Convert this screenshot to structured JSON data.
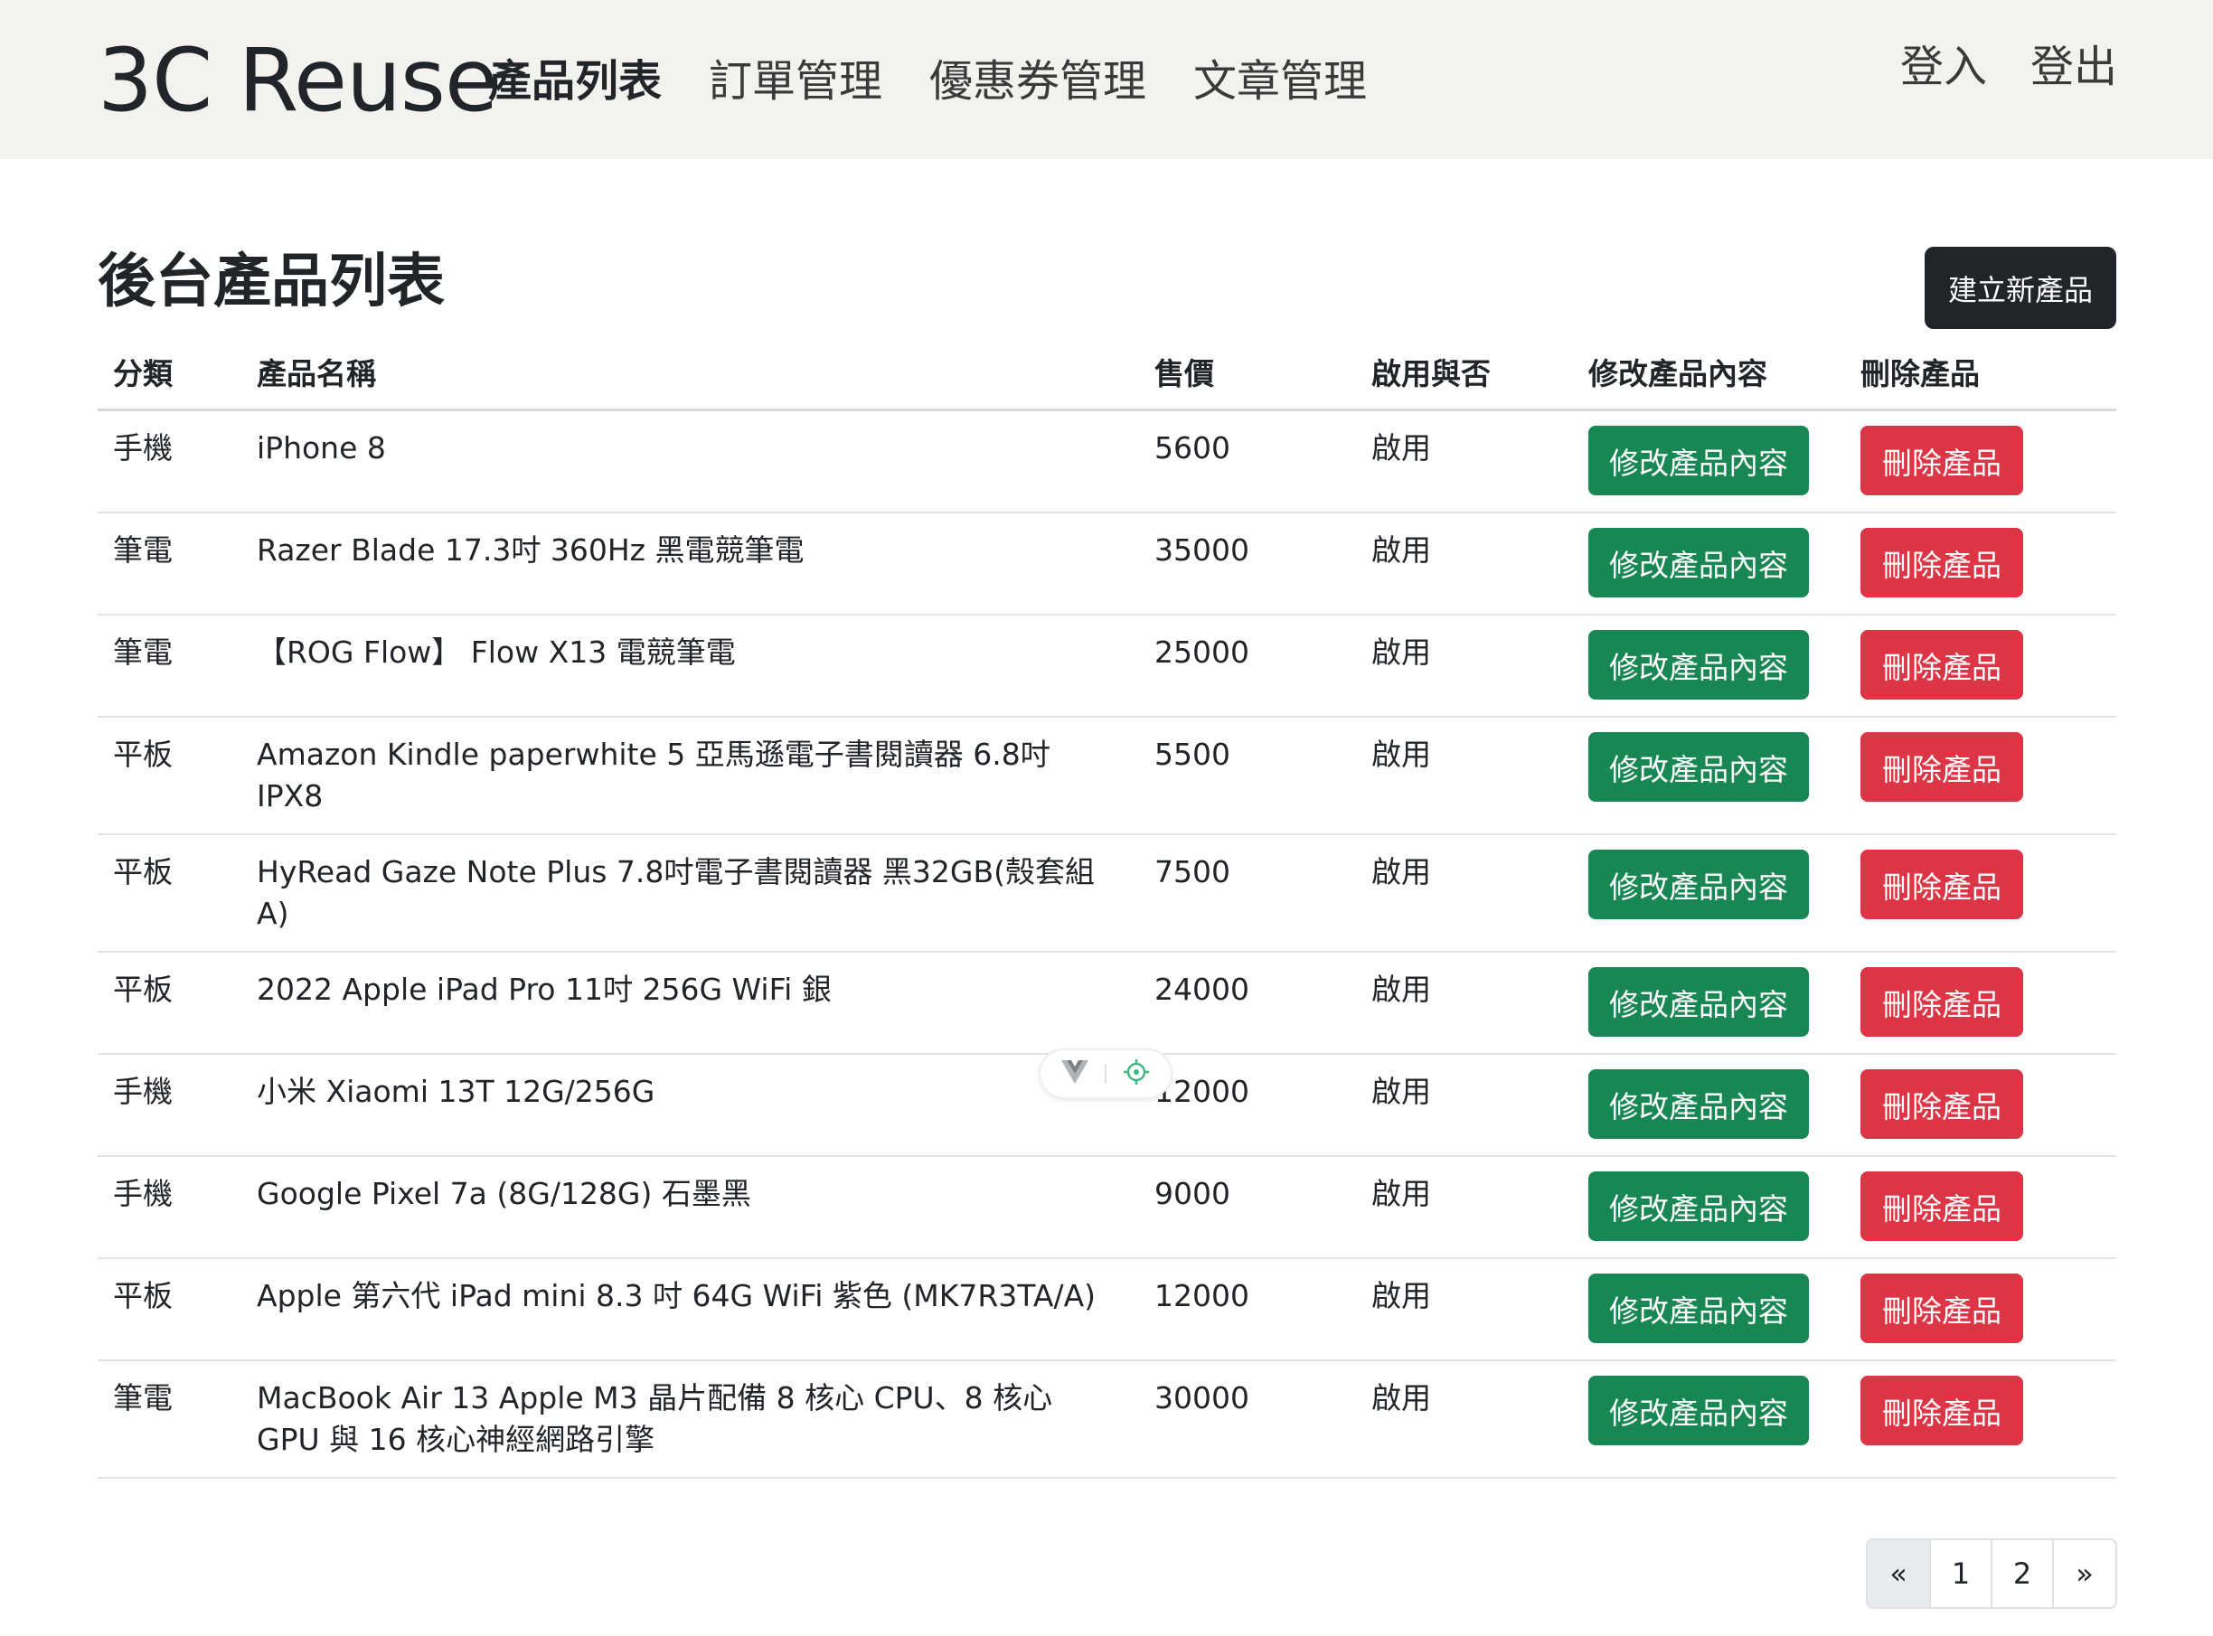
{
  "navbar": {
    "brand": "3C Reuse",
    "links": [
      {
        "label": "產品列表",
        "active": true
      },
      {
        "label": "訂單管理",
        "active": false
      },
      {
        "label": "優惠券管理",
        "active": false
      },
      {
        "label": "文章管理",
        "active": false
      }
    ],
    "login_label": "登入",
    "logout_label": "登出"
  },
  "page": {
    "title": "後台產品列表",
    "create_button_label": "建立新產品"
  },
  "table": {
    "headers": {
      "category": "分類",
      "name": "產品名稱",
      "price": "售價",
      "status": "啟用與否",
      "edit": "修改產品內容",
      "delete": "刪除產品"
    },
    "edit_button_label": "修改產品內容",
    "delete_button_label": "刪除產品",
    "rows": [
      {
        "category": "手機",
        "name": "iPhone 8",
        "price": "5600",
        "status": "啟用"
      },
      {
        "category": "筆電",
        "name": "Razer Blade 17.3吋 360Hz 黑電競筆電",
        "price": "35000",
        "status": "啟用"
      },
      {
        "category": "筆電",
        "name": "【ROG Flow】 Flow X13 電競筆電",
        "price": "25000",
        "status": "啟用"
      },
      {
        "category": "平板",
        "name": "Amazon Kindle paperwhite 5 亞馬遜電子書閱讀器 6.8吋 IPX8",
        "price": "5500",
        "status": "啟用"
      },
      {
        "category": "平板",
        "name": "HyRead Gaze Note Plus 7.8吋電子書閱讀器 黑32GB(殼套組A)",
        "price": "7500",
        "status": "啟用"
      },
      {
        "category": "平板",
        "name": "2022 Apple iPad Pro 11吋 256G WiFi 銀",
        "price": "24000",
        "status": "啟用"
      },
      {
        "category": "手機",
        "name": "小米 Xiaomi 13T 12G/256G",
        "price": "12000",
        "status": "啟用"
      },
      {
        "category": "手機",
        "name": "Google Pixel 7a (8G/128G) 石墨黑",
        "price": "9000",
        "status": "啟用"
      },
      {
        "category": "平板",
        "name": "Apple 第六代 iPad mini 8.3 吋 64G WiFi 紫色 (MK7R3TA/A)",
        "price": "12000",
        "status": "啟用"
      },
      {
        "category": "筆電",
        "name": "MacBook Air 13 Apple M3 晶片配備 8 核心 CPU、8 核心 GPU 與 16 核心神經網路引擎",
        "price": "30000",
        "status": "啟用"
      }
    ]
  },
  "pagination": {
    "prev": "«",
    "pages": [
      "1",
      "2"
    ],
    "next": "»"
  },
  "colors": {
    "navbar_bg": "#f3f2ef",
    "edit_button": "#198754",
    "delete_button": "#dc3545",
    "create_button": "#212529",
    "vue_logo": "#41b883"
  },
  "icons": {
    "devtools_logo": "vue-logo-icon",
    "devtools_inspect": "crosshair-icon"
  }
}
